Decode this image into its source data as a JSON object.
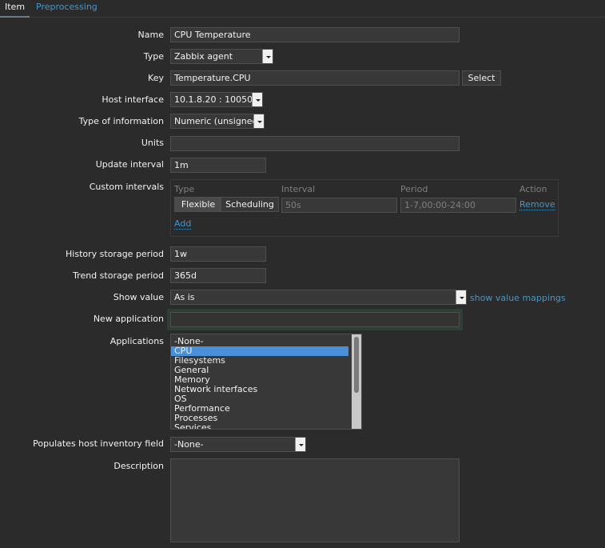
{
  "tabs": [
    {
      "label": "Item",
      "selected": true
    },
    {
      "label": "Preprocessing",
      "selected": false
    }
  ],
  "form": {
    "name": {
      "label": "Name",
      "value": "CPU Temperature"
    },
    "type": {
      "label": "Type",
      "value": "Zabbix agent"
    },
    "key": {
      "label": "Key",
      "value": "Temperature.CPU",
      "button": "Select"
    },
    "host_interface": {
      "label": "Host interface",
      "value": "10.1.8.20 : 10050"
    },
    "type_of_information": {
      "label": "Type of information",
      "value": "Numeric (unsigned)"
    },
    "units": {
      "label": "Units",
      "value": ""
    },
    "update_interval": {
      "label": "Update interval",
      "value": "1m"
    },
    "custom_intervals": {
      "label": "Custom intervals",
      "headers": {
        "type": "Type",
        "interval": "Interval",
        "period": "Period",
        "action": "Action"
      },
      "row": {
        "flexible": "Flexible",
        "scheduling": "Scheduling",
        "selected_type": "Flexible",
        "interval_placeholder": "50s",
        "period_placeholder": "1-7,00:00-24:00",
        "remove": "Remove"
      },
      "add": "Add"
    },
    "history": {
      "label": "History storage period",
      "value": "1w"
    },
    "trend": {
      "label": "Trend storage period",
      "value": "365d"
    },
    "show_value": {
      "label": "Show value",
      "value": "As is",
      "link": "show value mappings"
    },
    "new_application": {
      "label": "New application",
      "value": ""
    },
    "applications": {
      "label": "Applications",
      "items": [
        "-None-",
        "CPU",
        "Filesystems",
        "General",
        "Memory",
        "Network interfaces",
        "OS",
        "Performance",
        "Processes",
        "Services"
      ],
      "selected": "CPU"
    },
    "inventory": {
      "label": "Populates host inventory field",
      "value": "-None-"
    },
    "description": {
      "label": "Description",
      "value": ""
    }
  },
  "colors": {
    "background": "#2b2b2b",
    "link": "#4796c4",
    "selection": "#4a8fd9"
  }
}
